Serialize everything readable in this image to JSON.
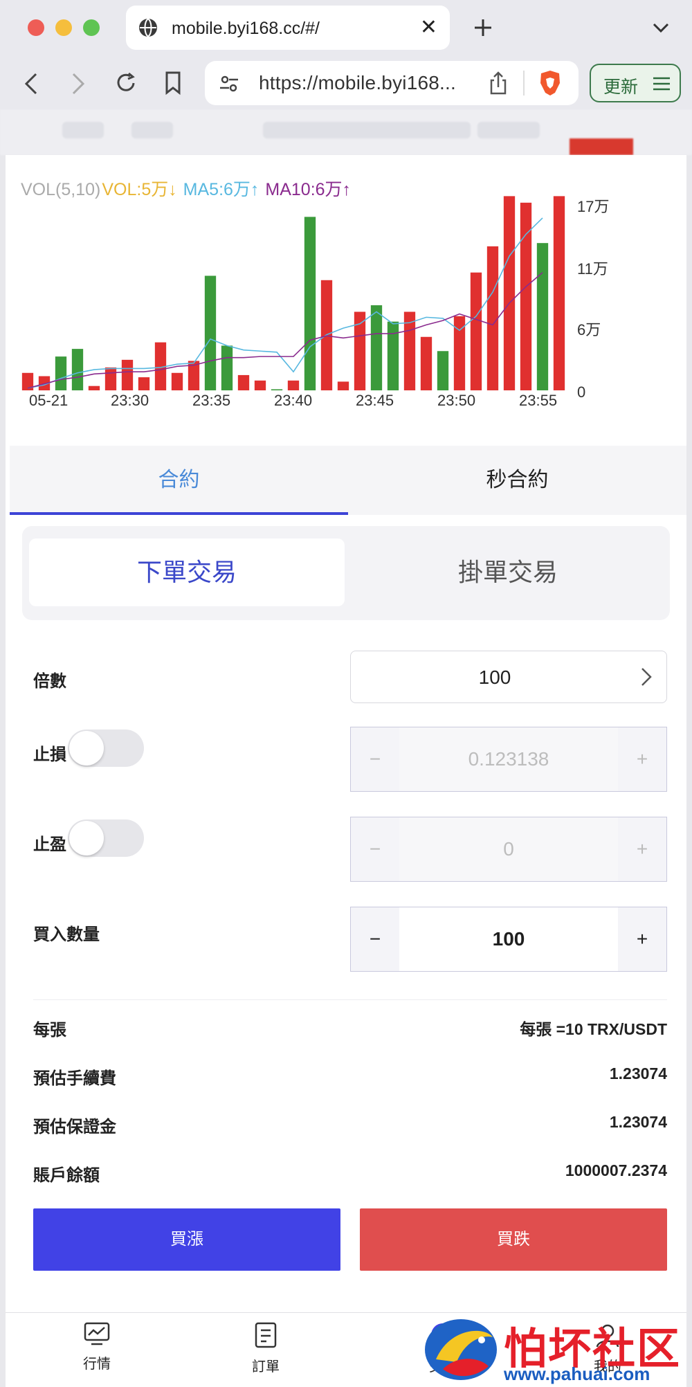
{
  "browser": {
    "tab_title": "mobile.byi168.cc/#/",
    "url": "https://mobile.byi168...",
    "update_label": "更新",
    "colors": {
      "close": "#ee5d56",
      "minimize": "#f5be3d",
      "maximize": "#5fc453"
    }
  },
  "chart_data": {
    "type": "bar",
    "legend": {
      "vol_label": "VOL(5,10)",
      "vol": "VOL:5万↓",
      "ma5": "MA5:6万↑",
      "ma10": "MA10:6万↑"
    },
    "x_tick_labels": [
      "05-21",
      "23:30",
      "23:35",
      "23:40",
      "23:45",
      "23:50",
      "23:55"
    ],
    "y_tick_labels": [
      "17万",
      "11万",
      "6万",
      "0"
    ],
    "ylim": [
      0,
      170000
    ],
    "bars": [
      {
        "v": 16000,
        "dir": "down"
      },
      {
        "v": 13000,
        "dir": "down"
      },
      {
        "v": 31000,
        "dir": "up"
      },
      {
        "v": 38000,
        "dir": "up"
      },
      {
        "v": 4000,
        "dir": "down"
      },
      {
        "v": 21000,
        "dir": "down"
      },
      {
        "v": 28000,
        "dir": "down"
      },
      {
        "v": 12000,
        "dir": "down"
      },
      {
        "v": 44000,
        "dir": "down"
      },
      {
        "v": 16000,
        "dir": "down"
      },
      {
        "v": 27000,
        "dir": "down"
      },
      {
        "v": 105000,
        "dir": "up"
      },
      {
        "v": 41000,
        "dir": "up"
      },
      {
        "v": 14000,
        "dir": "down"
      },
      {
        "v": 9000,
        "dir": "down"
      },
      {
        "v": 1000,
        "dir": "up"
      },
      {
        "v": 9000,
        "dir": "down"
      },
      {
        "v": 159000,
        "dir": "up"
      },
      {
        "v": 101000,
        "dir": "down"
      },
      {
        "v": 8000,
        "dir": "down"
      },
      {
        "v": 72000,
        "dir": "down"
      },
      {
        "v": 78000,
        "dir": "up"
      },
      {
        "v": 63000,
        "dir": "up"
      },
      {
        "v": 72000,
        "dir": "down"
      },
      {
        "v": 49000,
        "dir": "down"
      },
      {
        "v": 36000,
        "dir": "up"
      },
      {
        "v": 68000,
        "dir": "down"
      },
      {
        "v": 108000,
        "dir": "down"
      },
      {
        "v": 132000,
        "dir": "down"
      },
      {
        "v": 178000,
        "dir": "down"
      },
      {
        "v": 172000,
        "dir": "down"
      },
      {
        "v": 135000,
        "dir": "up"
      },
      {
        "v": 178000,
        "dir": "down"
      }
    ],
    "ma5": [
      2,
      5,
      11,
      16,
      19,
      20,
      20,
      20,
      21,
      24,
      25,
      47,
      41,
      37,
      36,
      35,
      17,
      40,
      51,
      57,
      61,
      72,
      61,
      62,
      67,
      66,
      55,
      68,
      90,
      123,
      143,
      158
    ],
    "ma10": [
      2,
      6,
      10,
      12,
      15,
      16,
      17,
      17,
      19,
      22,
      23,
      27,
      30,
      30,
      31,
      31,
      31,
      46,
      50,
      48,
      50,
      52,
      52,
      55,
      60,
      64,
      70,
      65,
      60,
      80,
      95,
      108
    ],
    "colors": {
      "up": "#3b9a3b",
      "down": "#e0302f",
      "ma5": "#58b8e0",
      "ma10": "#8a2b8e"
    }
  },
  "product_tabs": {
    "contract": "合約",
    "seconds": "秒合約"
  },
  "order_type": {
    "market": "下單交易",
    "limit": "掛單交易"
  },
  "form": {
    "leverage_label": "倍數",
    "leverage_value": "100",
    "stop_loss_label": "止損",
    "stop_loss_value": "0.123138",
    "take_profit_label": "止盈",
    "take_profit_value": "0",
    "quantity_label": "買入數量",
    "quantity_value": "100",
    "minus": "−",
    "plus": "+"
  },
  "info": {
    "per_contract_label": "每張",
    "per_contract_value": "每張 =10 TRX/USDT",
    "fee_label": "預估手續費",
    "fee_value": "1.23074",
    "margin_label": "預估保證金",
    "margin_value": "1.23074",
    "balance_label": "賬戶餘額",
    "balance_value": "1000007.2374"
  },
  "actions": {
    "buy_up": "買漲",
    "buy_down": "買跌"
  },
  "bottom_nav": {
    "market": "行情",
    "orders": "訂單",
    "trade": "交易",
    "mine": "我的"
  },
  "watermark": {
    "text": "怕坏社区",
    "url": "www.pahuai.com"
  }
}
